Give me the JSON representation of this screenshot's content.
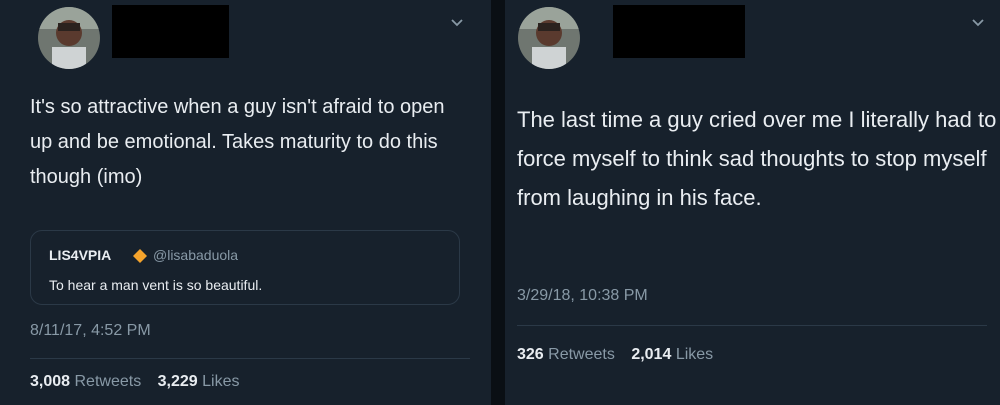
{
  "tweets": [
    {
      "text": "It's so attractive when a guy isn't afraid to open up and be emotional. Takes maturity to do this though (imo)",
      "quote": {
        "name": "LIS4VPIA",
        "handle": "@lisabaduola",
        "text": "To hear a man vent is so beautiful."
      },
      "timestamp": "8/11/17, 4:52 PM",
      "retweets_count": "3,008",
      "retweets_label": "Retweets",
      "likes_count": "3,229",
      "likes_label": "Likes"
    },
    {
      "text": "The last time a guy cried over me I literally had to force myself to think sad thoughts to stop myself from laughing in his face.",
      "timestamp": "3/29/18, 10:38 PM",
      "retweets_count": "326",
      "retweets_label": "Retweets",
      "likes_count": "2,014",
      "likes_label": "Likes"
    }
  ],
  "colors": {
    "background": "#17212c",
    "text": "#e9edf1",
    "muted": "#8899a6",
    "border": "#2b3947",
    "verified_badge": "#f4a32c"
  },
  "icons": [
    "avatar",
    "chevron-down-icon",
    "verified-badge-icon"
  ]
}
